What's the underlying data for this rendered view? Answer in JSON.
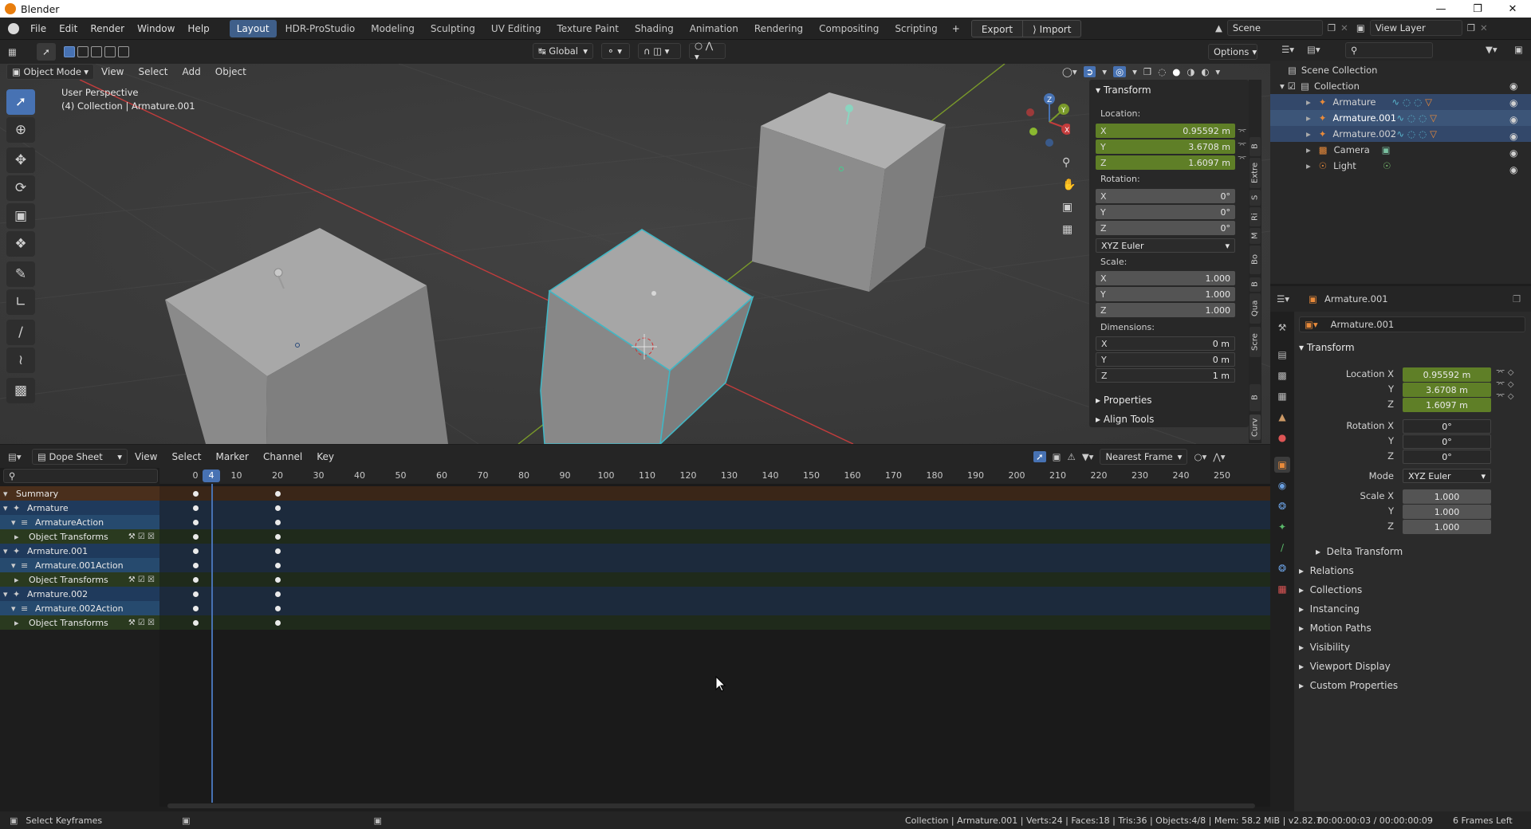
{
  "window": {
    "title": "Blender"
  },
  "menu": [
    "File",
    "Edit",
    "Render",
    "Window",
    "Help"
  ],
  "workspaces": [
    "Layout",
    "HDR-ProStudio",
    "Modeling",
    "Sculpting",
    "UV Editing",
    "Texture Paint",
    "Shading",
    "Animation",
    "Rendering",
    "Compositing",
    "Scripting"
  ],
  "active_workspace": "Layout",
  "topbar": {
    "export_label": "Export",
    "import_label": "Import",
    "scene": "Scene",
    "view_layer": "View Layer"
  },
  "viewport": {
    "mode": "Object Mode",
    "menus": [
      "View",
      "Select",
      "Add",
      "Object"
    ],
    "transform_orientation": "Global",
    "options_label": "Options",
    "overlay_line1": "User Perspective",
    "overlay_line2": "(4) Collection | Armature.001",
    "gizmo_axes": [
      "X",
      "Y",
      "Z"
    ]
  },
  "npanel": {
    "transform_title": "Transform",
    "location_label": "Location:",
    "location": [
      {
        "axis": "X",
        "value": "0.95592 m"
      },
      {
        "axis": "Y",
        "value": "3.6708 m"
      },
      {
        "axis": "Z",
        "value": "1.6097 m"
      }
    ],
    "rotation_label": "Rotation:",
    "rotation": [
      {
        "axis": "X",
        "value": "0°"
      },
      {
        "axis": "Y",
        "value": "0°"
      },
      {
        "axis": "Z",
        "value": "0°"
      }
    ],
    "rotation_mode": "XYZ Euler",
    "scale_label": "Scale:",
    "scale": [
      {
        "axis": "X",
        "value": "1.000"
      },
      {
        "axis": "Y",
        "value": "1.000"
      },
      {
        "axis": "Z",
        "value": "1.000"
      }
    ],
    "dimensions_label": "Dimensions:",
    "dimensions": [
      {
        "axis": "X",
        "value": "0 m"
      },
      {
        "axis": "Y",
        "value": "0 m"
      },
      {
        "axis": "Z",
        "value": "1 m"
      }
    ],
    "properties_label": "Properties",
    "align_tools_label": "Align Tools",
    "tabs": [
      "Curv",
      "B",
      "Scre",
      "Qua",
      "B",
      "Bo",
      "M",
      "Ri",
      "S",
      "Extre",
      "B"
    ]
  },
  "outliner": {
    "root": "Scene Collection",
    "collection": "Collection",
    "items": [
      {
        "name": "Armature",
        "selected": true
      },
      {
        "name": "Armature.001",
        "selected": true
      },
      {
        "name": "Armature.002",
        "selected": true
      },
      {
        "name": "Camera",
        "selected": false
      },
      {
        "name": "Light",
        "selected": false
      }
    ]
  },
  "properties": {
    "object_name": "Armature.001",
    "object_field": "Armature.001",
    "transform_label": "Transform",
    "location_x_label": "Location X",
    "location": [
      "0.95592 m",
      "3.6708 m",
      "1.6097 m"
    ],
    "rotation_x_label": "Rotation X",
    "rotation": [
      "0°",
      "0°",
      "0°"
    ],
    "mode_label": "Mode",
    "mode_value": "XYZ Euler",
    "scale_x_label": "Scale X",
    "scale": [
      "1.000",
      "1.000",
      "1.000"
    ],
    "y_label": "Y",
    "z_label": "Z",
    "sections": [
      "Delta Transform",
      "Relations",
      "Collections",
      "Instancing",
      "Motion Paths",
      "Visibility",
      "Viewport Display",
      "Custom Properties"
    ]
  },
  "dopesheet": {
    "editor": "Dope Sheet",
    "menus": [
      "View",
      "Select",
      "Marker",
      "Channel",
      "Key"
    ],
    "snapping": "Nearest Frame",
    "current_frame": "4",
    "ruler": [
      "0",
      "10",
      "20",
      "30",
      "40",
      "50",
      "60",
      "70",
      "80",
      "90",
      "100",
      "110",
      "120",
      "130",
      "140",
      "150",
      "160",
      "170",
      "180",
      "190",
      "200",
      "210",
      "220",
      "230",
      "240",
      "250"
    ],
    "channels": [
      {
        "label": "Summary",
        "kind": "summary"
      },
      {
        "label": "Armature",
        "kind": "object"
      },
      {
        "label": "ArmatureAction",
        "kind": "action"
      },
      {
        "label": "Object Transforms",
        "kind": "group"
      },
      {
        "label": "Armature.001",
        "kind": "object"
      },
      {
        "label": "Armature.001Action",
        "kind": "action"
      },
      {
        "label": "Object Transforms",
        "kind": "group"
      },
      {
        "label": "Armature.002",
        "kind": "object"
      },
      {
        "label": "Armature.002Action",
        "kind": "action"
      },
      {
        "label": "Object Transforms",
        "kind": "group"
      }
    ],
    "keyframes": [
      0,
      20
    ]
  },
  "statusbar": {
    "hint": "Select Keyframes",
    "stats": "Collection | Armature.001 | Verts:24 | Faces:18 | Tris:36 | Objects:4/8 | Mem: 58.2 MiB | v2.82.7",
    "time": "00:00:00:03 / 00:00:00:09",
    "frames_left": "6 Frames Left"
  },
  "colors": {
    "accent": "#4772b3",
    "keyed": "#5f7f27",
    "selected_row": "#33486a",
    "active_frame": "#4772b3"
  }
}
